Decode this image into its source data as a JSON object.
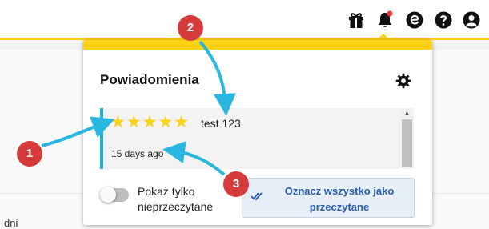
{
  "notifications": {
    "title": "Powiadomienia",
    "items": [
      {
        "rating_stars": "★★★★★",
        "text": "test 123",
        "time": "15 days ago"
      }
    ],
    "toggle_label": "Pokaż tylko nieprzeczytane",
    "mark_all_label": "Oznacz wszystko jako przeczytane"
  },
  "background": {
    "partial_text": "dni"
  },
  "topbar_icons": [
    "gift-icon",
    "bell-icon",
    "e-circle-icon",
    "help-icon",
    "user-icon"
  ],
  "annotations": {
    "badges": [
      "1",
      "2",
      "3"
    ]
  },
  "colors": {
    "accent": "#fcd116",
    "unread_border": "#1bb5d0",
    "link": "#2a5db0",
    "badge": "#d63b3b",
    "arrow": "#29b6e0",
    "notification_dot": "#e53935"
  }
}
